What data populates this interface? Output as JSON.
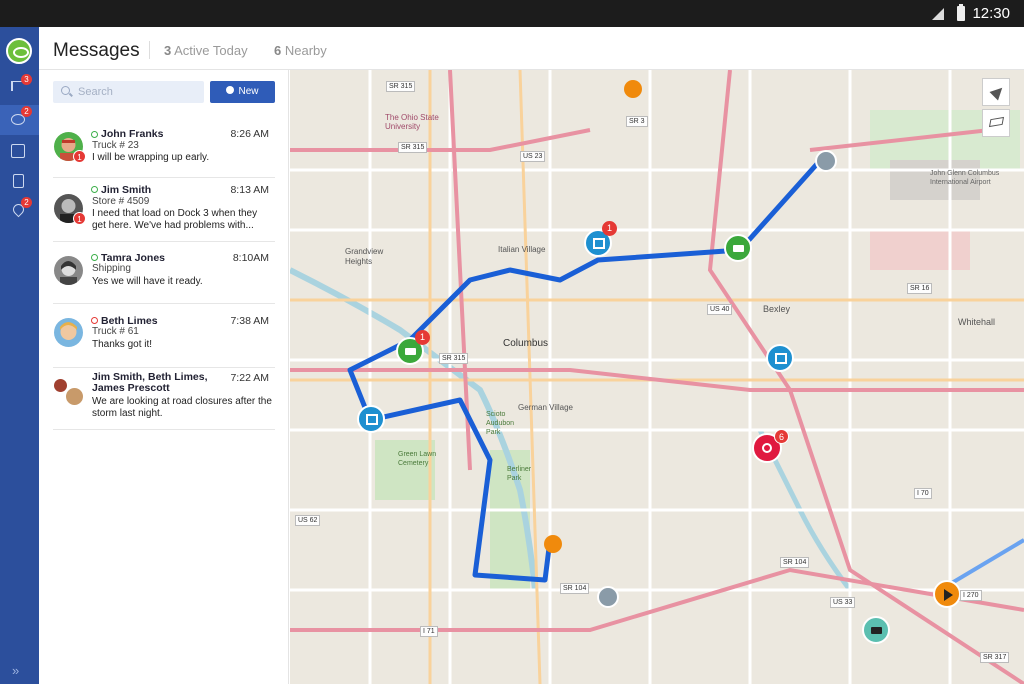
{
  "status_bar": {
    "time": "12:30"
  },
  "rail": {
    "badges": {
      "alerts": "3",
      "messages": "2",
      "locations": "2"
    },
    "items": [
      "alerts",
      "messages",
      "calendar",
      "devices",
      "locations"
    ]
  },
  "header": {
    "title": "Messages",
    "active_count": "3",
    "active_label": "Active Today",
    "nearby_count": "6",
    "nearby_label": "Nearby"
  },
  "search": {
    "placeholder": "Search"
  },
  "new_button": {
    "label": "New"
  },
  "messages": [
    {
      "name": "John Franks",
      "time": "8:26 AM",
      "sub": "Truck # 23",
      "text": "I will be wrapping up early.",
      "badge": "1",
      "status": "online"
    },
    {
      "name": "Jim Smith",
      "time": "8:13 AM",
      "sub": "Store # 4509",
      "text": "I need that load on Dock 3 when they get here. We've had problems with...",
      "badge": "1",
      "status": "online"
    },
    {
      "name": "Tamra Jones",
      "time": "8:10AM",
      "sub": "Shipping",
      "text": "Yes we will have it ready.",
      "badge": "",
      "status": "online"
    },
    {
      "name": "Beth Limes",
      "time": "7:38 AM",
      "sub": "Truck # 61",
      "text": "Thanks got it!",
      "badge": "",
      "status": "busy"
    },
    {
      "name": "Jim Smith, Beth Limes, James Prescott",
      "time": "7:22 AM",
      "sub": "",
      "text": "We are looking at road closures after the storm last night.",
      "badge": "",
      "status": ""
    }
  ],
  "map": {
    "labels": [
      "Columbus",
      "Italian Village",
      "German Village",
      "Grandview Heights",
      "Bexley",
      "Whitehall",
      "Green Lawn Cemetery",
      "The Ohio State University",
      "John Glenn Columbus International Airport",
      "Scioto Audubon Park",
      "Berliner Park"
    ],
    "shields": [
      "SR 315",
      "SR 315",
      "SR 315",
      "US 23",
      "SR 3",
      "SR 16",
      "US 40",
      "US 62",
      "US 33",
      "SR 104",
      "SR 104",
      "I 71",
      "I 70",
      "I 270",
      "SR 317",
      "US 62"
    ],
    "markers": {
      "truck_badge": "1",
      "store_badge": "1",
      "alert_badge": "6"
    },
    "colors": {
      "route": "#1a5fd6",
      "truck": "#3ba83b",
      "store": "#1e90d0",
      "alert": "#e0193f",
      "poi": "#f08a0c"
    }
  }
}
